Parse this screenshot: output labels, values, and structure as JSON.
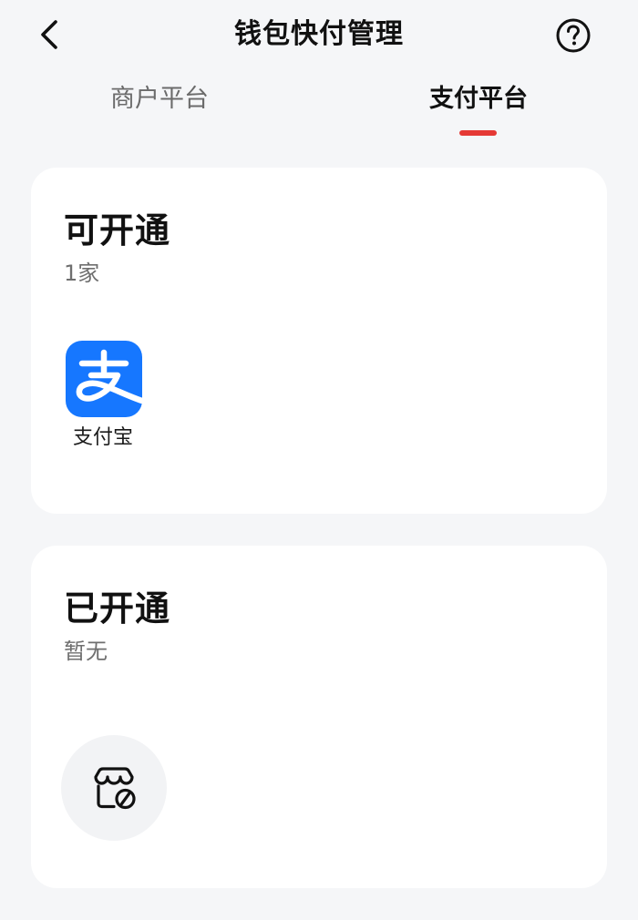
{
  "header": {
    "title": "钱包快付管理",
    "back_icon": "chevron-left-icon",
    "help_icon": "question-circle-icon"
  },
  "tabs": [
    {
      "label": "商户平台",
      "active": false
    },
    {
      "label": "支付平台",
      "active": true
    }
  ],
  "colors": {
    "background": "#f5f6f8",
    "card": "#ffffff",
    "tab_indicator": "#e53935",
    "alipay_blue": "#1677ff"
  },
  "available": {
    "title": "可开通",
    "count": "1家",
    "providers": [
      {
        "name": "支付宝",
        "icon": "alipay-icon"
      }
    ]
  },
  "opened": {
    "title": "已开通",
    "status": "暂无",
    "empty_icon": "store-disabled-icon"
  }
}
